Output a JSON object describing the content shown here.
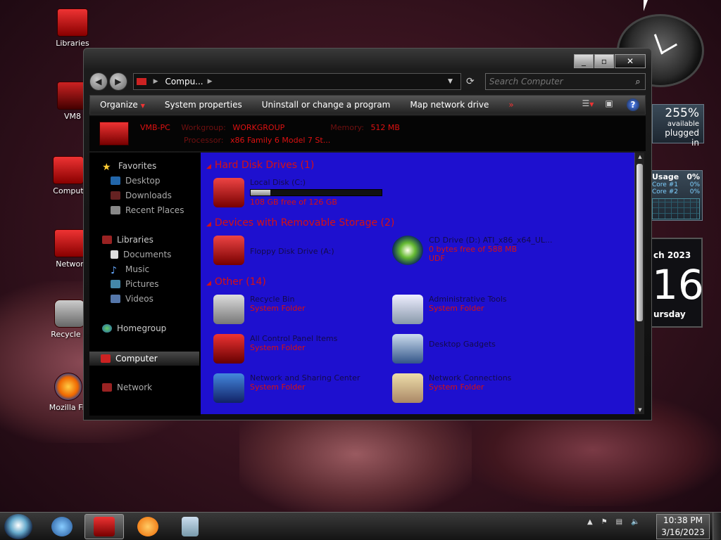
{
  "desktop": {
    "icons": [
      {
        "label": "Libraries"
      },
      {
        "label": "VM8"
      },
      {
        "label": "Comput"
      },
      {
        "label": "Networ"
      },
      {
        "label": "Recycle B"
      },
      {
        "label": "Mozilla Fir"
      }
    ]
  },
  "gadgets": {
    "battery": {
      "percent": "255%",
      "status1": "available",
      "status2": "plugged in"
    },
    "cpu": {
      "title": "Usage",
      "total": "0%",
      "core1_label": "Core #1",
      "core1": "0%",
      "core2_label": "Core #2",
      "core2": "0%"
    },
    "calendar": {
      "month": "ch 2023",
      "day": "16",
      "weekday": "ursday"
    }
  },
  "window": {
    "buttons": {
      "minimize": "_",
      "maximize": "▫",
      "close": "✕"
    },
    "address": {
      "crumb": "Compu...",
      "search_placeholder": "Search Computer"
    },
    "toolbar": {
      "organize": "Organize",
      "system_properties": "System properties",
      "uninstall": "Uninstall or change a program",
      "map_drive": "Map network drive",
      "more": "»"
    },
    "details": {
      "computer_name": "VMB-PC",
      "workgroup_label": "Workgroup:",
      "workgroup": "WORKGROUP",
      "memory_label": "Memory:",
      "memory": "512 MB",
      "processor_label": "Processor:",
      "processor": "x86 Family 6 Model 7 St..."
    },
    "nav": {
      "favorites": "Favorites",
      "desktop": "Desktop",
      "downloads": "Downloads",
      "recent": "Recent Places",
      "libraries": "Libraries",
      "documents": "Documents",
      "music": "Music",
      "pictures": "Pictures",
      "videos": "Videos",
      "homegroup": "Homegroup",
      "computer": "Computer",
      "network": "Network"
    },
    "content": {
      "hdd_header": "Hard Disk Drives (1)",
      "local_disk": {
        "name": "Local Disk (C:)",
        "free": "108 GB free of 126 GB",
        "used_fraction": 0.15
      },
      "removable_header": "Devices with Removable Storage (2)",
      "floppy": {
        "name": "Floppy Disk Drive (A:)"
      },
      "cd": {
        "name": "CD Drive (D:) ATI_x86_x64_UL...",
        "free": "0 bytes free of 588 MB",
        "fs": "UDF"
      },
      "other_header": "Other (14)",
      "other_items": [
        {
          "name": "Recycle Bin",
          "type": "System Folder"
        },
        {
          "name": "Administrative Tools",
          "type": "System Folder"
        },
        {
          "name": "All Control Panel Items",
          "type": "System Folder"
        },
        {
          "name": "Desktop Gadgets",
          "type": ""
        },
        {
          "name": "Network and Sharing Center",
          "type": "System Folder"
        },
        {
          "name": "Network Connections",
          "type": "System Folder"
        }
      ]
    }
  },
  "taskbar": {
    "time": "10:38 PM",
    "date": "3/16/2023",
    "tray_arrow": "▲"
  }
}
